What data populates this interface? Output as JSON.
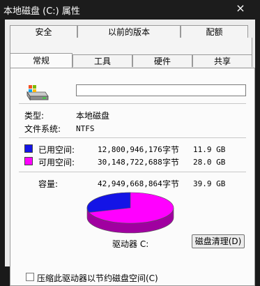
{
  "window": {
    "title": "本地磁盘 (C:) 属性",
    "close_glyph": "×"
  },
  "tabs_row1": [
    "安全",
    "以前的版本",
    "配额"
  ],
  "tabs_row2": [
    "常规",
    "工具",
    "硬件",
    "共享"
  ],
  "general": {
    "name_value": "",
    "type_label": "类型:",
    "type_value": "本地磁盘",
    "fs_label": "文件系统:",
    "fs_value": "NTFS",
    "used": {
      "label": "已用空间:",
      "bytes": "12,800,946,176",
      "unit": "字节",
      "size": "11.9 GB",
      "color": "#1414e6"
    },
    "free": {
      "label": "可用空间:",
      "bytes": "30,148,722,688",
      "unit": "字节",
      "size": "28.0 GB",
      "color": "#ff00ff"
    },
    "capacity": {
      "label": "容量:",
      "bytes": "42,949,668,864",
      "unit": "字节",
      "size": "39.9 GB"
    },
    "drive_label": "驱动器 C:",
    "cleanup_button": "磁盘清理(D)",
    "compress_label": "压缩此驱动器以节约磁盘空间(C)",
    "compress_checked": false
  },
  "icons": {
    "drive": "hard-drive-icon"
  }
}
